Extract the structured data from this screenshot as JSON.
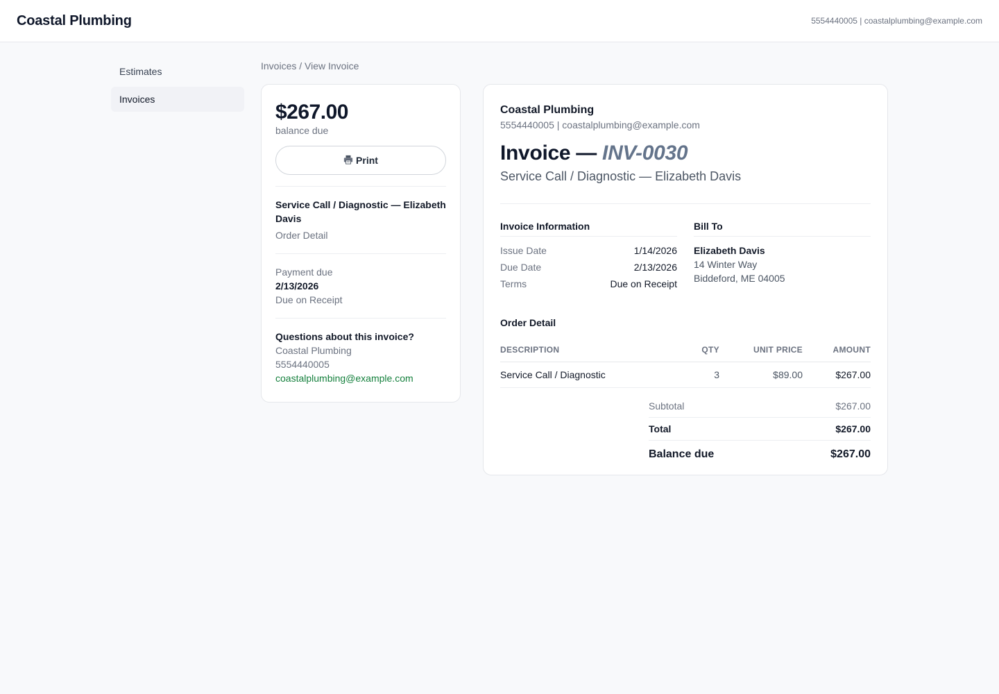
{
  "header": {
    "brand": "Coastal Plumbing",
    "contact": "5554440005 | coastalplumbing@example.com"
  },
  "sidebar": {
    "items": [
      {
        "label": "Estimates"
      },
      {
        "label": "Invoices"
      }
    ]
  },
  "breadcrumb": "Invoices / View Invoice",
  "summary": {
    "amount": "$267.00",
    "amount_caption": "balance due",
    "print_icon": "printer-icon",
    "print_label": "Print",
    "job_title": "Service Call / Diagnostic — Elizabeth Davis",
    "job_sub": "Order Detail",
    "payment_label": "Payment due",
    "payment_date": "2/13/2026",
    "payment_terms": "Due on Receipt",
    "questions_title": "Questions about this invoice?",
    "company": "Coastal Plumbing",
    "phone": "5554440005",
    "email": "coastalplumbing@example.com"
  },
  "invoice": {
    "company": "Coastal Plumbing",
    "company_contact": "5554440005 | coastalplumbing@example.com",
    "title_prefix": "Invoice — ",
    "number": "INV-0030",
    "subtitle": "Service Call / Diagnostic — Elizabeth Davis",
    "info_heading": "Invoice Information",
    "info": [
      {
        "k": "Issue Date",
        "v": "1/14/2026"
      },
      {
        "k": "Due Date",
        "v": "2/13/2026"
      },
      {
        "k": "Terms",
        "v": "Due on Receipt"
      }
    ],
    "bill_heading": "Bill To",
    "bill_name": "Elizabeth Davis",
    "bill_address1": "14 Winter Way",
    "bill_address2": "Biddeford, ME 04005",
    "order_heading": "Order Detail",
    "columns": [
      "DESCRIPTION",
      "QTY",
      "UNIT PRICE",
      "AMOUNT"
    ],
    "rows": [
      {
        "description": "Service Call / Diagnostic",
        "qty": "3",
        "unit_price": "$89.00",
        "amount": "$267.00"
      }
    ],
    "subtotal_label": "Subtotal",
    "subtotal": "$267.00",
    "total_label": "Total",
    "total": "$267.00",
    "balance_label": "Balance due",
    "balance": "$267.00"
  },
  "colors": {
    "accent_link": "#15803d",
    "background": "#f8f9fb"
  }
}
